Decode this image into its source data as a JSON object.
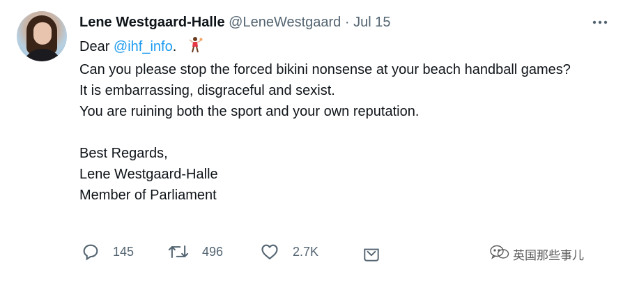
{
  "tweet": {
    "author_name": "Lene Westgaard-Halle",
    "handle": "@LeneWestgaard",
    "separator": "·",
    "date": "Jul 15",
    "avatar_icon": "profile-photo",
    "more_icon": "more-horizontal-icon",
    "body": {
      "greeting_prefix": "Dear ",
      "mention": "@ihf_info",
      "greeting_suffix": ".",
      "emoji": "woman-handball-emoji",
      "line1": "Can you please stop the forced bikini nonsense at your beach handball games?",
      "line2": "It is embarrassing, disgraceful and sexist.",
      "line3": "You are ruining both the sport and your own reputation.",
      "closing": "Best Regards,",
      "signature_name": "Lene Westgaard-Halle",
      "signature_title": "Member of Parliament"
    },
    "actions": {
      "reply_count": "145",
      "retweet_count": "496",
      "like_count": "2.7K",
      "reply_icon": "reply-icon",
      "retweet_icon": "retweet-icon",
      "like_icon": "heart-icon",
      "share_icon": "share-icon"
    },
    "colors": {
      "text": "#0f1419",
      "secondary": "#536471",
      "link": "#1d9bf0"
    }
  },
  "watermark": {
    "text": "英国那些事儿",
    "icon": "wechat-logo-icon"
  }
}
